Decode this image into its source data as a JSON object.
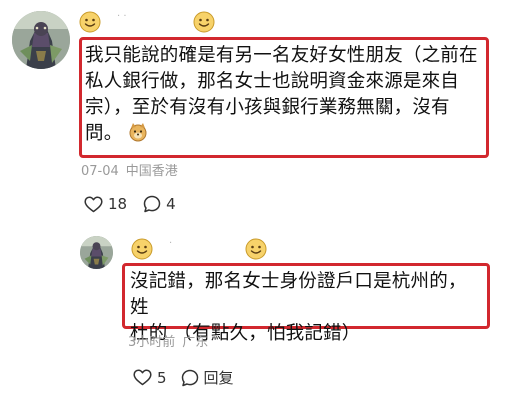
{
  "main_comment": {
    "username_hidden": "· ·",
    "text": "我只能說的確是有另一名友好女性朋友（之前在\n私人銀行做，那名女士也說明資金來源是來自\n宗），至於有沒有小孩與銀行業務無關，沒有\n問。",
    "date": "07-04",
    "location": "中国香港",
    "likes": "18",
    "replies": "4",
    "box_color": "#d2282e"
  },
  "reply_comment": {
    "username_hidden": "·",
    "text": "沒記錯，那名女士身份證戶口是杭州的，姓\n杜的 （有點久，怕我記錯）",
    "time": "3小时前",
    "location": "广东",
    "likes": "5",
    "reply_label": "回复",
    "box_color": "#d2282e"
  },
  "icons": {
    "like": "heart-outline-icon",
    "comment": "speech-bubble-icon",
    "emoji": "smiling-face-emoji-icon",
    "inline_emoji": "doge-face-emoji-icon"
  }
}
